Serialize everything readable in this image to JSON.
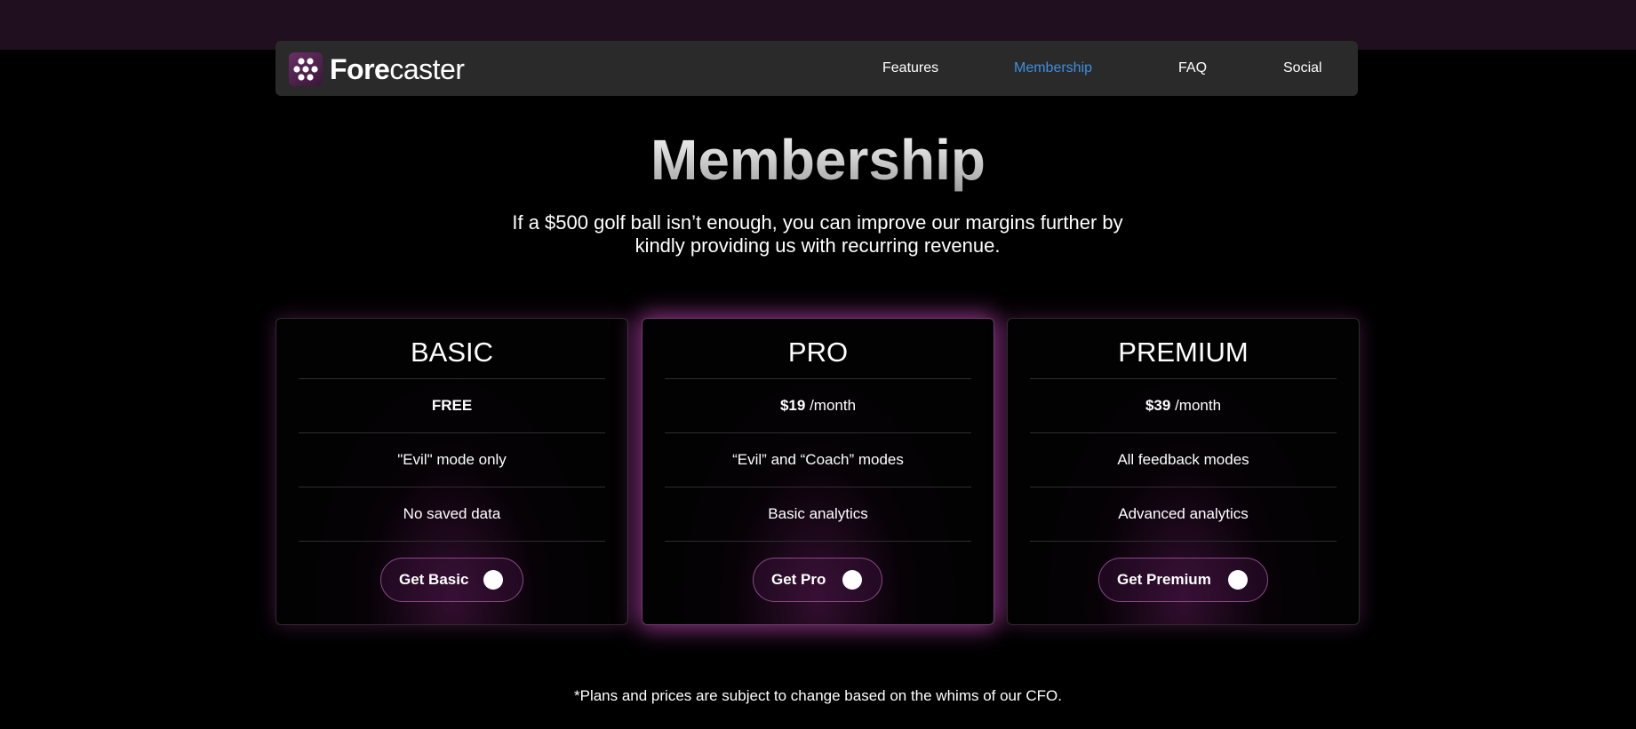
{
  "brand": {
    "name_bold": "Fore",
    "name_light": "caster",
    "logo_icon": "dice-dots-icon"
  },
  "nav": {
    "items": [
      {
        "label": "Features",
        "active": false
      },
      {
        "label": "Membership",
        "active": true
      },
      {
        "label": "FAQ",
        "active": false
      },
      {
        "label": "Social",
        "active": false
      }
    ]
  },
  "colors": {
    "accent_active": "#3d8fe0",
    "glow": "#be46b4",
    "top_strip": "#1f0f1f"
  },
  "hero": {
    "title": "Membership",
    "subtitle": "If a $500 golf ball isn’t enough, you can improve our margins further by kindly providing us with recurring revenue."
  },
  "plans": [
    {
      "name": "BASIC",
      "price_amount": "FREE",
      "price_period": "",
      "feature_1": "\"Evil\" mode only",
      "feature_2": "No saved data",
      "cta": "Get Basic",
      "featured": false
    },
    {
      "name": "PRO",
      "price_amount": "$19",
      "price_period": "/month",
      "feature_1": "“Evil” and “Coach” modes",
      "feature_2": "Basic analytics",
      "cta": "Get Pro",
      "featured": true
    },
    {
      "name": "PREMIUM",
      "price_amount": "$39",
      "price_period": "/month",
      "feature_1": "All feedback modes",
      "feature_2": "Advanced analytics",
      "cta": "Get Premium",
      "featured": false
    }
  ],
  "footnote": "*Plans and prices are subject to change based on the whims of our CFO."
}
